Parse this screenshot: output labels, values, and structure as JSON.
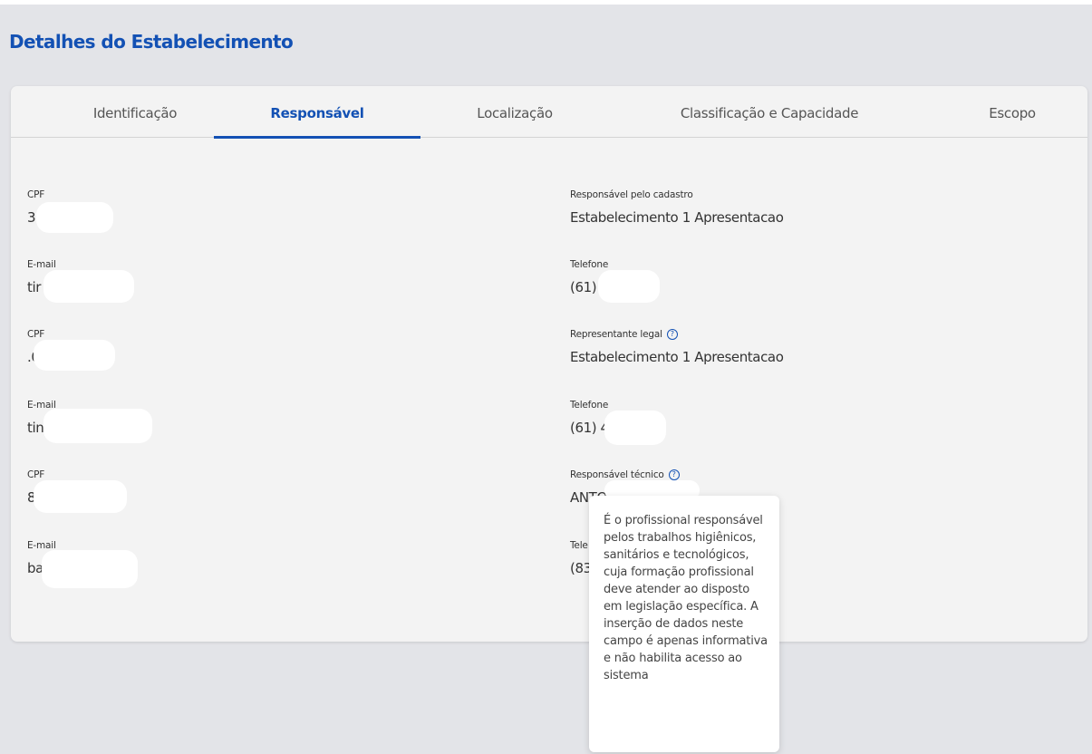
{
  "page": {
    "title": "Detalhes do Estabelecimento"
  },
  "tabs": [
    {
      "label": "Identificação"
    },
    {
      "label": "Responsável",
      "active": true
    },
    {
      "label": "Localização"
    },
    {
      "label": "Classificação e Capacidade"
    },
    {
      "label": "Escopo"
    }
  ],
  "left_fields": [
    {
      "label": "CPF",
      "value": "3:                 .00"
    },
    {
      "label": "E-mail",
      "value": "tir                        ailt.net"
    },
    {
      "label": "CPF",
      "value": "                     .00"
    },
    {
      "label": "E-mail",
      "value": "tin                           .net"
    },
    {
      "label": "CPF",
      "value": "                    88"
    },
    {
      "label": "E-mail",
      "value": "ba                       mail.com"
    }
  ],
  "right_fields": [
    {
      "label": "Responsável pelo cadastro",
      "value": "Estabelecimento 1 Apresentacao"
    },
    {
      "label": "Telefone",
      "value": "(61) ·                55"
    },
    {
      "label": "Representante legal",
      "value": "Estabelecimento 1 Apresentacao",
      "help": true
    },
    {
      "label": "Telefone",
      "value": "(61) 4                5"
    },
    {
      "label": "Responsável técnico",
      "value": "ANTONIO ALBE    SO",
      "help": true
    },
    {
      "label": "Tele",
      "value": "(83"
    }
  ],
  "tooltip": {
    "text": "É o profissional responsável pelos trabalhos higiênicos, sanitários e tecnológicos, cuja formação profissional deve atender ao disposto em legislação específica. A inserção de dados neste campo é apenas informativa e não habilita acesso ao sistema"
  },
  "icons": {
    "help": "question-circle-icon"
  },
  "colors": {
    "accent": "#1351b4",
    "background": "#e3e4e8",
    "card": "#f3f3f3"
  }
}
